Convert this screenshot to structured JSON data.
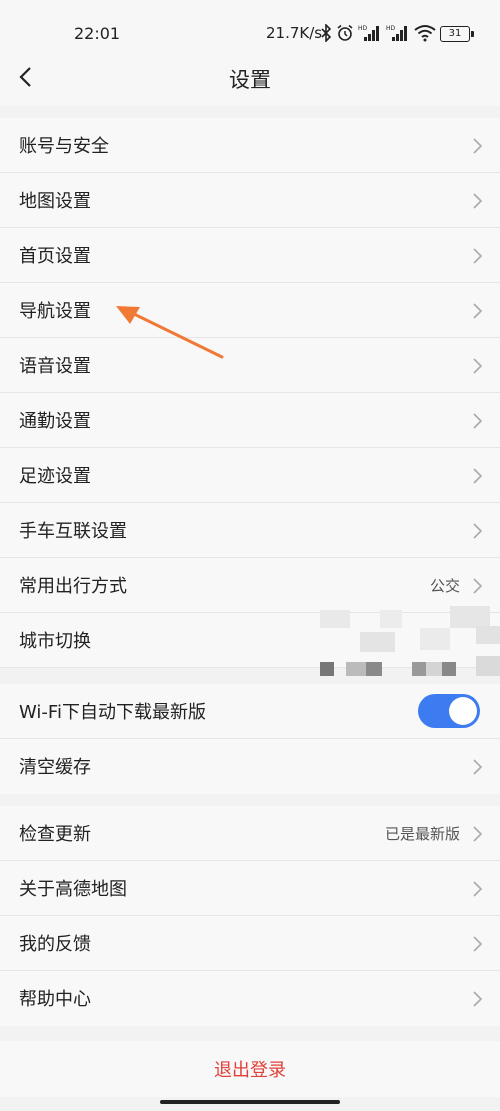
{
  "status_bar": {
    "time": "22:01",
    "net_speed": "21.7K/s",
    "battery": "31",
    "icons": [
      "bluetooth-icon",
      "alarm-icon",
      "signal-hd-icon",
      "signal-hd-icon",
      "wifi-icon",
      "battery-icon"
    ]
  },
  "header": {
    "title": "设置",
    "back_icon": "chevron-left-icon"
  },
  "group1": [
    {
      "label": "账号与安全"
    },
    {
      "label": "地图设置"
    },
    {
      "label": "首页设置"
    },
    {
      "label": "导航设置"
    },
    {
      "label": "语音设置"
    },
    {
      "label": "通勤设置"
    },
    {
      "label": "足迹设置"
    },
    {
      "label": "手车互联设置"
    },
    {
      "label": "常用出行方式",
      "value": "公交"
    },
    {
      "label": "城市切换"
    }
  ],
  "group2": [
    {
      "label": "Wi-Fi下自动下载最新版",
      "toggle_on": true
    },
    {
      "label": "清空缓存"
    }
  ],
  "group3": [
    {
      "label": "检查更新",
      "value": "已是最新版"
    },
    {
      "label": "关于高德地图"
    },
    {
      "label": "我的反馈"
    },
    {
      "label": "帮助中心"
    }
  ],
  "logout": {
    "label": "退出登录"
  },
  "colors": {
    "accent": "#3d7bf0",
    "logout": "#e0413a",
    "annotation_arrow": "#f07a35"
  }
}
